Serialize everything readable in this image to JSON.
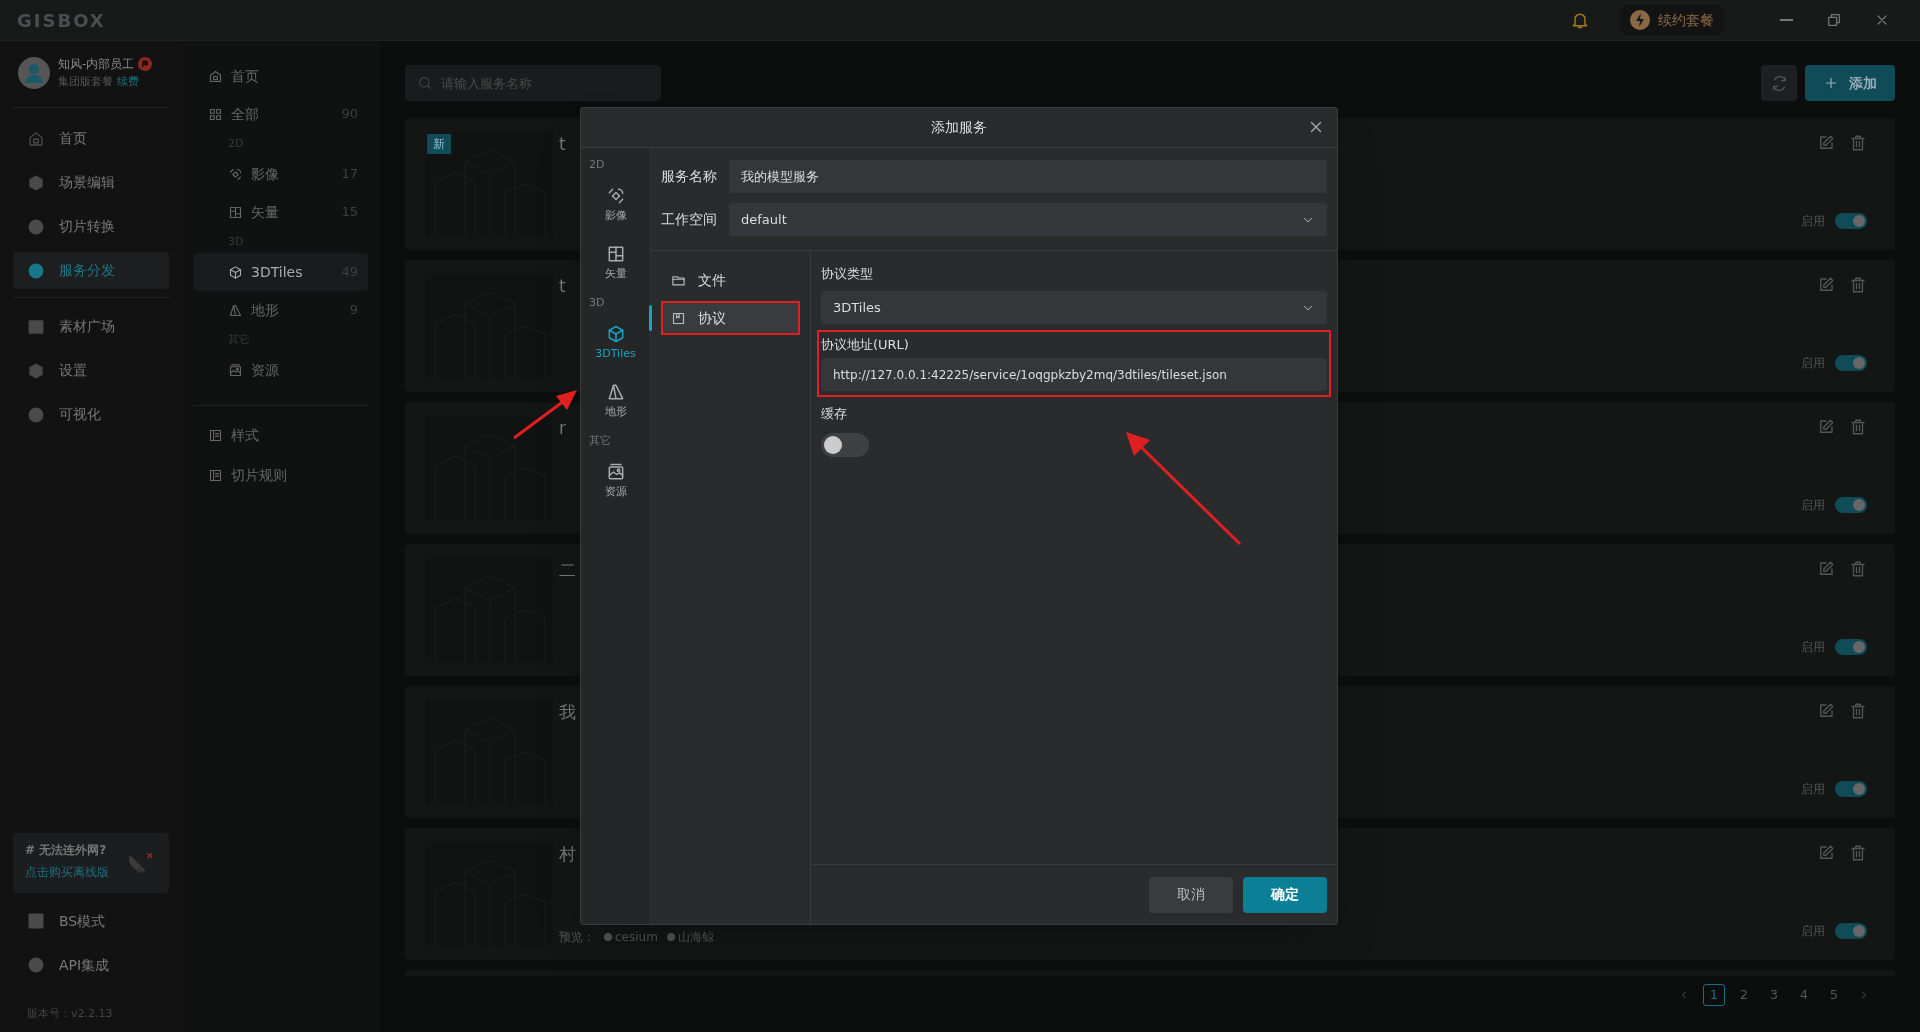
{
  "title_bar": {
    "logo": "GISBOX",
    "renew_button": "续约套餐"
  },
  "user": {
    "name": "知风-内部员工",
    "plan": "集团版套餐",
    "renew_link": "续费"
  },
  "nav_main": [
    {
      "label": "首页",
      "selected": false
    },
    {
      "label": "场景编辑",
      "selected": false
    },
    {
      "label": "切片转换",
      "selected": false
    },
    {
      "label": "服务分发",
      "selected": true
    }
  ],
  "nav_more": [
    {
      "label": "素材广场",
      "selected": false
    },
    {
      "label": "设置",
      "selected": false
    },
    {
      "label": "可视化",
      "selected": false
    }
  ],
  "promo": {
    "title": "# 无法连外网?",
    "link": "点击购买离线版"
  },
  "nav_bottom": [
    {
      "label": "BS模式"
    },
    {
      "label": "API集成"
    }
  ],
  "version": "版本号：v2.2.13",
  "category_nav": [
    {
      "kind": "item",
      "label": "首页",
      "selected": false
    },
    {
      "kind": "item",
      "label": "全部",
      "count": "90",
      "selected": false
    },
    {
      "kind": "group",
      "label": "2D"
    },
    {
      "kind": "sub",
      "label": "影像",
      "count": "17",
      "selected": false
    },
    {
      "kind": "sub",
      "label": "矢量",
      "count": "15",
      "selected": false
    },
    {
      "kind": "group",
      "label": "3D"
    },
    {
      "kind": "sub",
      "label": "3DTiles",
      "count": "49",
      "selected": true
    },
    {
      "kind": "sub",
      "label": "地形",
      "count": "9",
      "selected": false
    },
    {
      "kind": "group",
      "label": "其它"
    },
    {
      "kind": "sub",
      "label": "资源",
      "selected": false
    }
  ],
  "category_extra": [
    {
      "label": "样式"
    },
    {
      "label": "切片规则"
    }
  ],
  "search": {
    "placeholder": "请输入服务名称"
  },
  "add_button": "添加",
  "cards": [
    {
      "title": "t",
      "badge": "新",
      "enabled": true,
      "enable_label": "启用"
    },
    {
      "title": "t",
      "enabled": true,
      "enable_label": "启用"
    },
    {
      "title": "r",
      "enabled": true,
      "enable_label": "启用"
    },
    {
      "title": "二",
      "enabled": true,
      "enable_label": "启用"
    },
    {
      "title": "我",
      "enabled": true,
      "enable_label": "启用"
    },
    {
      "title": "村",
      "enabled": true,
      "enable_label": "启用",
      "preview": {
        "label": "预览：",
        "links": [
          "cesium",
          "山海鲸"
        ]
      }
    }
  ],
  "pagination": [
    {
      "label": "1",
      "selected": true
    },
    {
      "label": "2",
      "selected": false
    },
    {
      "label": "3",
      "selected": false
    },
    {
      "label": "4",
      "selected": false
    },
    {
      "label": "5",
      "selected": false
    }
  ],
  "dialog": {
    "title": "添加服务",
    "types": [
      {
        "kind": "group",
        "label": "2D"
      },
      {
        "kind": "type",
        "label": "影像",
        "selected": false
      },
      {
        "kind": "type",
        "label": "矢量",
        "selected": false
      },
      {
        "kind": "group",
        "label": "3D"
      },
      {
        "kind": "type",
        "label": "3DTiles",
        "selected": true
      },
      {
        "kind": "type",
        "label": "地形",
        "selected": false
      },
      {
        "kind": "group",
        "label": "其它"
      },
      {
        "kind": "type",
        "label": "资源",
        "selected": false
      }
    ],
    "service_name": {
      "label": "服务名称",
      "value": "我的模型服务"
    },
    "workspace": {
      "label": "工作空间",
      "value": "default"
    },
    "sources": [
      {
        "label": "文件",
        "selected": false
      },
      {
        "label": "协议",
        "selected": true
      }
    ],
    "protocol_type": {
      "label": "协议类型",
      "value": "3DTiles"
    },
    "url": {
      "label": "协议地址(URL)",
      "value": "http://127.0.0.1:42225/service/1oqgpkzby2mq/3dtiles/tileset.json"
    },
    "cache": {
      "label": "缓存",
      "on": false
    },
    "buttons": [
      {
        "kind": "cancel",
        "label": "取消"
      },
      {
        "kind": "ok",
        "label": "确定"
      }
    ]
  }
}
